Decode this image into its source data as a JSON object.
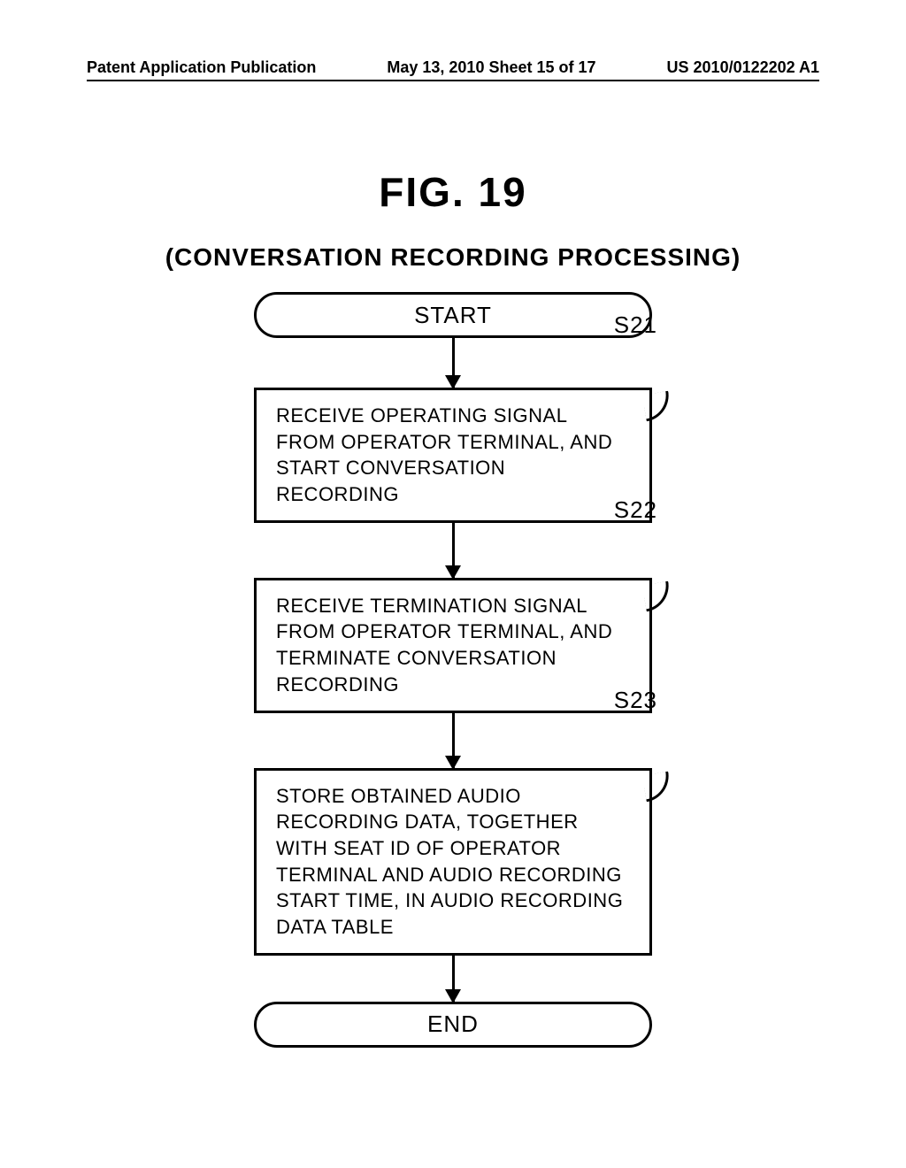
{
  "header": {
    "left": "Patent Application Publication",
    "center": "May 13, 2010  Sheet 15 of 17",
    "right": "US 2010/0122202 A1"
  },
  "figure": {
    "title": "FIG. 19",
    "subtitle": "(CONVERSATION RECORDING PROCESSING)"
  },
  "flow": {
    "start": "START",
    "end": "END",
    "steps": [
      {
        "label": "S21",
        "text": "RECEIVE OPERATING SIGNAL FROM OPERATOR TERMINAL, AND START CONVERSATION RECORDING"
      },
      {
        "label": "S22",
        "text": "RECEIVE TERMINATION SIGNAL FROM OPERATOR TERMINAL, AND TERMINATE CONVERSATION RECORDING"
      },
      {
        "label": "S23",
        "text": "STORE OBTAINED AUDIO RECORDING DATA, TOGETHER WITH SEAT ID OF OPERATOR TERMINAL AND AUDIO RECORDING START TIME, IN AUDIO RECORDING DATA TABLE"
      }
    ]
  }
}
